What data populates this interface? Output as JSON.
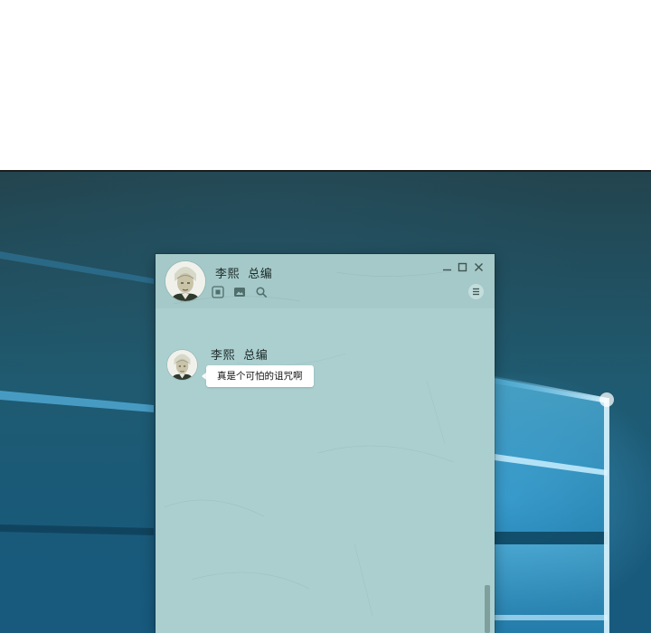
{
  "chat_window": {
    "contact_name": "李熙  总编",
    "toolbar_icons": [
      "stop-icon",
      "image-icon",
      "search-icon"
    ],
    "window_controls": [
      "minimize-icon",
      "maximize-icon",
      "close-icon"
    ],
    "menu_icon": "menu-icon"
  },
  "messages": [
    {
      "sender": "李熙  总编",
      "text": "真是个可怕的诅咒啊"
    }
  ],
  "colors": {
    "desktop_background": "#1a5a78",
    "desktop_light": "#7fd4f5",
    "window_background": "#a9cdcd",
    "bubble_background": "#ffffff",
    "text": "#1e2a2a"
  }
}
